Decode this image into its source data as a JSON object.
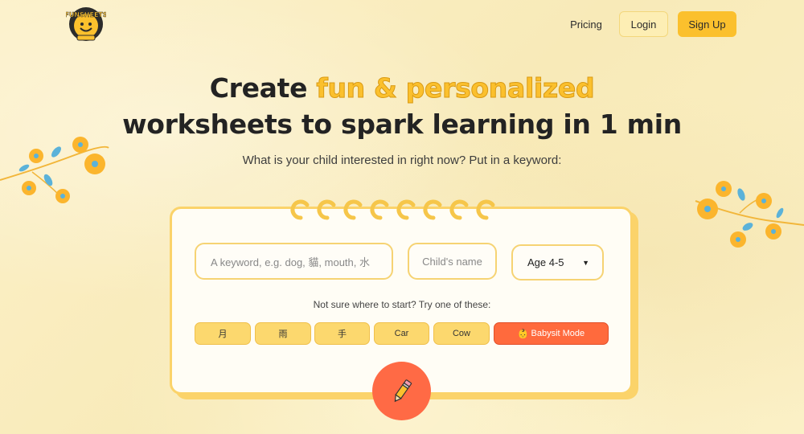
{
  "header": {
    "logo_name": "funsheets-logo",
    "pricing_label": "Pricing",
    "login_label": "Login",
    "signup_label": "Sign Up"
  },
  "hero": {
    "line1_prefix": "Create ",
    "line1_highlight": "fun & personalized",
    "line2": "worksheets to spark learning in 1 min",
    "subtitle": "What is your child interested in right now? Put in a keyword:"
  },
  "form": {
    "keyword_placeholder": "A keyword, e.g. dog, 貓, mouth, 水",
    "child_placeholder": "Child's name",
    "age_value": "Age 4-5"
  },
  "suggestions": {
    "hint": "Not sure where to start? Try one of these:",
    "chips": [
      "月",
      "雨",
      "手",
      "Car",
      "Cow"
    ],
    "babysit_emoji": "👶",
    "babysit_label": "Babysit Mode"
  },
  "icons": {
    "submit": "pencil-icon",
    "age_caret": "caret-down-icon"
  },
  "colors": {
    "accent": "#fbc02d",
    "card_border": "#fbd36a",
    "babysit": "#ff6a3d",
    "background": "#fbefc4"
  }
}
